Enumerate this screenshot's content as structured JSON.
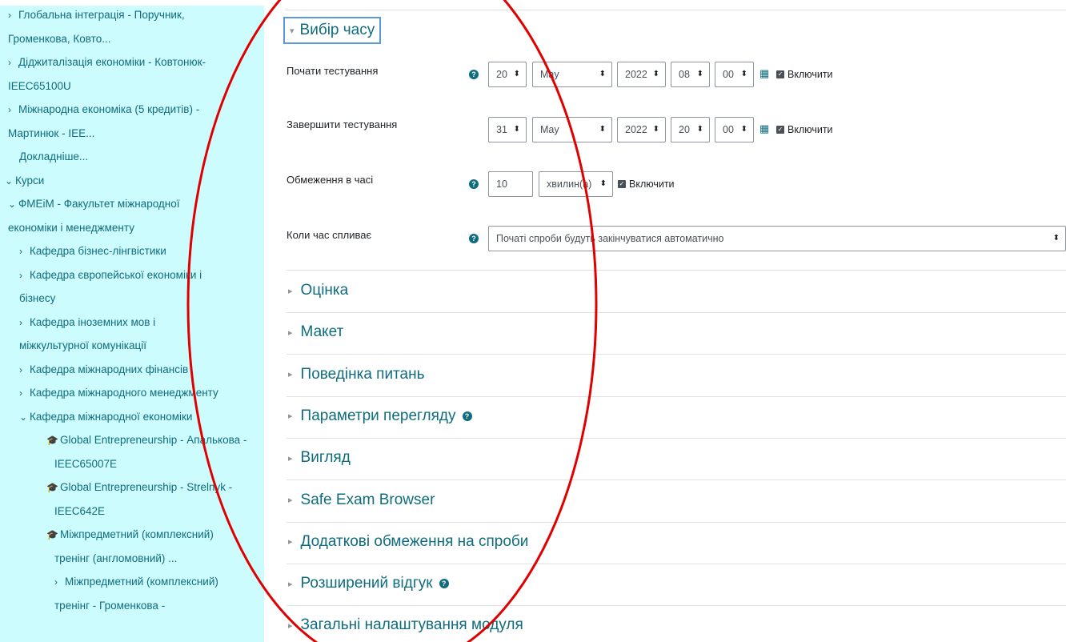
{
  "sidebar": {
    "items": [
      {
        "chev": "›",
        "text": "Глобальна інтеграція - Поручник,",
        "icon": ""
      },
      {
        "chev": "",
        "text": "Громенкова, Ковто...",
        "icon": ""
      },
      {
        "chev": "›",
        "text": "Діджиталізація економіки - Ковтонюк-",
        "icon": ""
      },
      {
        "chev": "",
        "text": "IEEC65100U",
        "icon": ""
      },
      {
        "chev": "›",
        "text": "Міжнародна економіка (5 кредитів) -",
        "icon": ""
      },
      {
        "chev": "",
        "text": "Мартинюк - IEE...",
        "icon": ""
      },
      {
        "chev": "",
        "text": "Докладніше...",
        "icon": ""
      },
      {
        "chev": "⌄",
        "text": "Курси",
        "icon": ""
      },
      {
        "chev": "⌄",
        "text": "ФМЕіМ - Факультет міжнародної",
        "icon": ""
      },
      {
        "chev": "",
        "text": "економіки і менеджменту",
        "icon": ""
      },
      {
        "chev": "›",
        "text": "Кафедра бізнес-лінгвістики",
        "icon": ""
      },
      {
        "chev": "›",
        "text": "Кафедра європейської економіки і",
        "icon": ""
      },
      {
        "chev": "",
        "text": "бізнесу",
        "icon": ""
      },
      {
        "chev": "›",
        "text": "Кафедра іноземних мов і",
        "icon": ""
      },
      {
        "chev": "",
        "text": "міжкультурної комунікації",
        "icon": ""
      },
      {
        "chev": "›",
        "text": "Кафедра міжнародних фінансів",
        "icon": ""
      },
      {
        "chev": "›",
        "text": "Кафедра міжнародного менеджменту",
        "icon": ""
      },
      {
        "chev": "⌄",
        "text": "Кафедра міжнародної економіки",
        "icon": ""
      },
      {
        "chev": "",
        "text": "Global Entrepreneurship - Апалькова -",
        "icon": "graduation-cap-icon"
      },
      {
        "chev": "",
        "text": "IEEC65007E",
        "icon": ""
      },
      {
        "chev": "",
        "text": "Global Entrepreneurship - Strelnyk -",
        "icon": "graduation-cap-icon"
      },
      {
        "chev": "",
        "text": "IEEC642E",
        "icon": ""
      },
      {
        "chev": "",
        "text": "Міжпредметний (комплексний)",
        "icon": "graduation-cap-icon"
      },
      {
        "chev": "",
        "text": "тренінг (англомовний) ...",
        "icon": ""
      },
      {
        "chev": "›",
        "text": "Міжпредметний (комплексний)",
        "icon": ""
      },
      {
        "chev": "",
        "text": "тренінг - Громенкова -",
        "icon": ""
      }
    ]
  },
  "timing": {
    "header": "Вибір часу",
    "open": {
      "label": "Почати тестування",
      "day": "20",
      "month": "May",
      "year": "2022",
      "hour": "08",
      "minute": "00",
      "enable": "Включити"
    },
    "close": {
      "label": "Завершити тестування",
      "day": "31",
      "month": "May",
      "year": "2022",
      "hour": "20",
      "minute": "00",
      "enable": "Включити"
    },
    "limit": {
      "label": "Обмеження в часі",
      "value": "10",
      "unit": "хвилин(а)",
      "enable": "Включити"
    },
    "overdue": {
      "label": "Коли час спливає",
      "value": "Початі спроби будуть закінчуватися автоматично"
    }
  },
  "sections": [
    {
      "label": "Оцінка",
      "help": false
    },
    {
      "label": "Макет",
      "help": false
    },
    {
      "label": "Поведінка питань",
      "help": false
    },
    {
      "label": "Параметри перегляду",
      "help": true
    },
    {
      "label": "Вигляд",
      "help": false
    },
    {
      "label": "Safe Exam Browser",
      "help": false
    },
    {
      "label": "Додаткові обмеження на спроби",
      "help": false
    },
    {
      "label": "Розширений відгук",
      "help": true
    },
    {
      "label": "Загальні налаштування модуля",
      "help": false
    }
  ],
  "glyphs": {
    "help": "?",
    "checkbox": "✓",
    "calendar": "▦",
    "select_arrow": "⬍",
    "collapsed": "▸",
    "expanded": "▾",
    "cap": "🎓"
  },
  "colors": {
    "sidebar_bg": "#ccfcfd",
    "accent": "#0f6c7e",
    "annotation": "#e00000",
    "focus_border": "#5b9bd5"
  }
}
